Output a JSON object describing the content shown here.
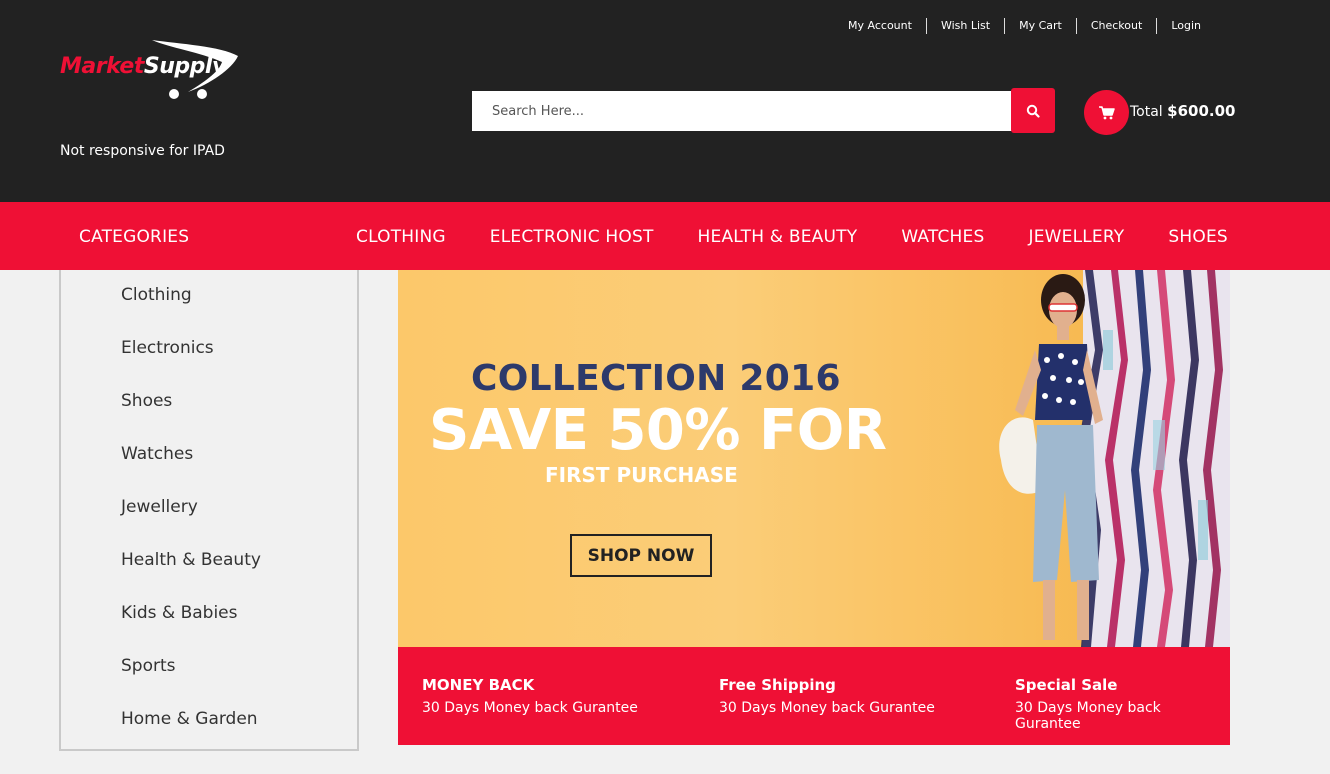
{
  "brand": {
    "logo_part1": "Market",
    "logo_part2": "Supply",
    "tagline": "Not responsive for IPAD"
  },
  "top_links": [
    "My Account",
    "Wish List",
    "My Cart",
    "Checkout",
    "Login"
  ],
  "search": {
    "placeholder": "Search Here..."
  },
  "cart": {
    "total_label": "Total",
    "total_value": "$600.00"
  },
  "nav": {
    "categories_label": "CATEGORIES",
    "items": [
      "CLOTHING",
      "ELECTRONIC HOST",
      "HEALTH & BEAUTY",
      "WATCHES",
      "JEWELLERY",
      "SHOES"
    ]
  },
  "sidebar": {
    "items": [
      "Clothing",
      "Electronics",
      "Shoes",
      "Watches",
      "Jewellery",
      "Health & Beauty",
      "Kids & Babies",
      "Sports",
      "Home & Garden"
    ]
  },
  "banner": {
    "line1": "COLLECTION 2016",
    "line2": "SAVE 50% FOR",
    "line3": "FIRST PURCHASE",
    "cta": "SHOP NOW"
  },
  "features": [
    {
      "title": "MONEY BACK",
      "subtitle": "30 Days Money back Gurantee"
    },
    {
      "title": "Free Shipping",
      "subtitle": "30 Days Money back Gurantee"
    },
    {
      "title": "Special Sale",
      "subtitle": "30 Days Money back Gurantee"
    }
  ],
  "colors": {
    "brand_red": "#ef1035",
    "header_dark": "#222222"
  },
  "icons": {
    "search": "search-icon",
    "cart": "cart-icon"
  }
}
